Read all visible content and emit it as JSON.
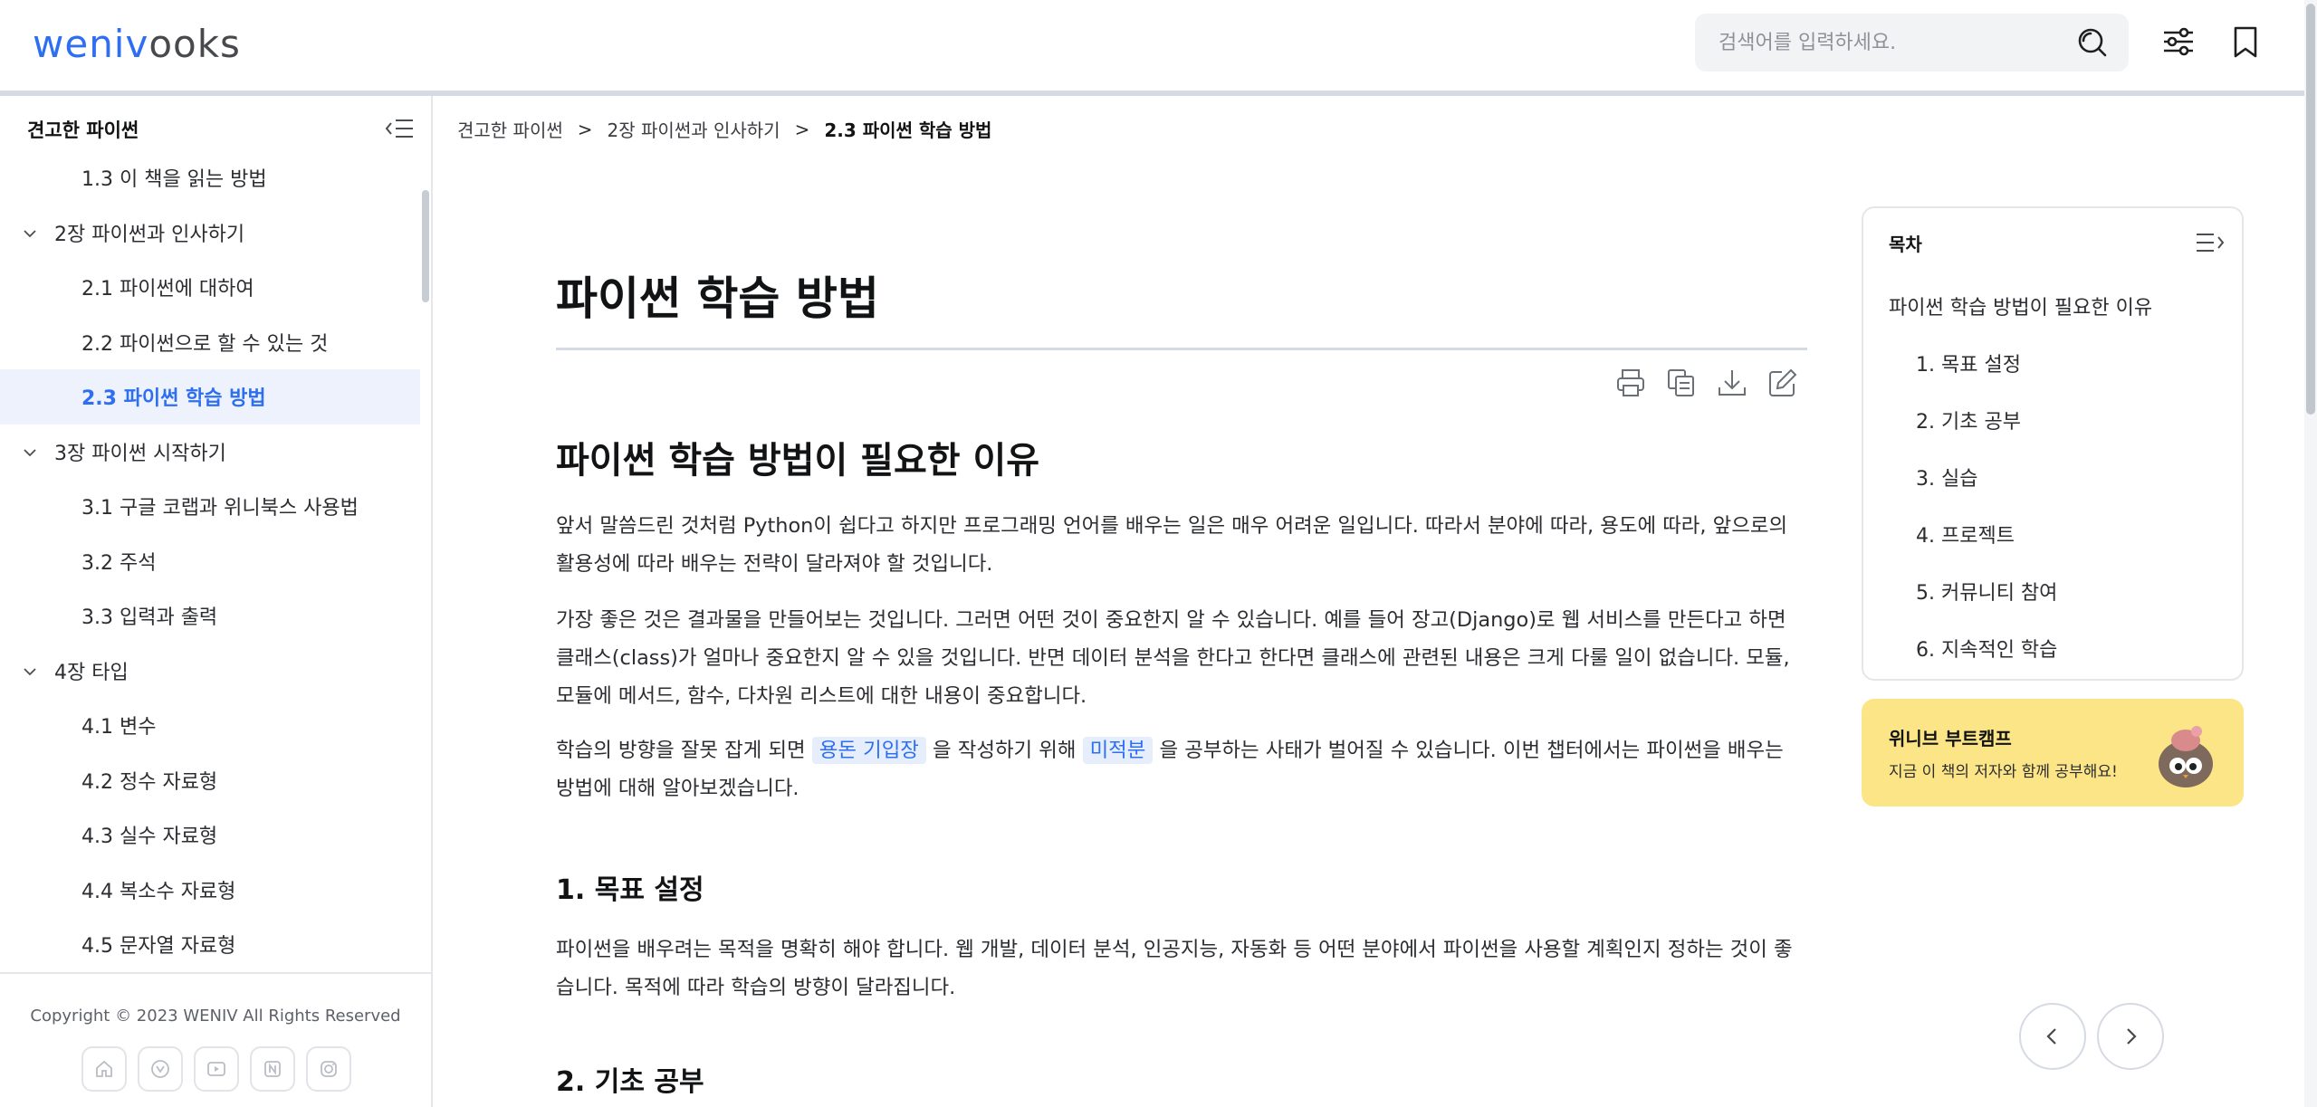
{
  "header": {
    "logo_primary": "weniv",
    "logo_secondary": "ooks",
    "search_placeholder": "검색어를 입력하세요."
  },
  "sidebar": {
    "title": "견고한 파이썬",
    "items": [
      {
        "label": "1.3 이 책을 읽는 방법",
        "level": "sub"
      },
      {
        "label": "2장 파이썬과 인사하기",
        "level": "chap"
      },
      {
        "label": "2.1 파이썬에 대하여",
        "level": "sub"
      },
      {
        "label": "2.2 파이썬으로 할 수 있는 것",
        "level": "sub"
      },
      {
        "label": "2.3 파이썬 학습 방법",
        "level": "sub",
        "active": true
      },
      {
        "label": "3장 파이썬 시작하기",
        "level": "chap"
      },
      {
        "label": "3.1 구글 코랩과 위니북스 사용법",
        "level": "sub"
      },
      {
        "label": "3.2 주석",
        "level": "sub"
      },
      {
        "label": "3.3 입력과 출력",
        "level": "sub"
      },
      {
        "label": "4장 타입",
        "level": "chap"
      },
      {
        "label": "4.1 변수",
        "level": "sub"
      },
      {
        "label": "4.2 정수 자료형",
        "level": "sub"
      },
      {
        "label": "4.3 실수 자료형",
        "level": "sub"
      },
      {
        "label": "4.4 복소수 자료형",
        "level": "sub"
      },
      {
        "label": "4.5 문자열 자료형",
        "level": "sub"
      }
    ],
    "copyright": "Copyright © 2023 WENIV All Rights Reserved"
  },
  "breadcrumb": {
    "items": [
      "견고한 파이썬",
      "2장 파이썬과 인사하기",
      "2.3 파이썬 학습 방법"
    ],
    "separator": ">"
  },
  "main": {
    "title": "파이썬 학습 방법",
    "section_title": "파이썬 학습 방법이 필요한 이유",
    "p1": "앞서 말씀드린 것처럼 Python이 쉽다고 하지만 프로그래밍 언어를 배우는 일은 매우 어려운 일입니다. 따라서 분야에 따라, 용도에 따라, 앞으로의 활용성에 따라 배우는 전략이 달라져야 할 것입니다.",
    "p2": "가장 좋은 것은 결과물을 만들어보는 것입니다. 그러면 어떤 것이 중요한지 알 수 있습니다. 예를 들어 장고(Django)로 웹 서비스를 만든다고 하면 클래스(class)가 얼마나 중요한지 알 수 있을 것입니다. 반면 데이터 분석을 한다고 한다면 클래스에 관련된 내용은 크게 다룰 일이 없습니다. 모듈, 모듈에 메서드, 함수, 다차원 리스트에 대한 내용이 중요합니다.",
    "p3_a": "학습의 방향을 잘못 잡게 되면 ",
    "p3_hl1": "용돈 기입장",
    "p3_b": " 을 작성하기 위해 ",
    "p3_hl2": "미적분",
    "p3_c": " 을 공부하는 사태가 벌어질 수 있습니다. 이번 챕터에서는 파이썬을 배우는 방법에 대해 알아보겠습니다.",
    "h_goal": "1. 목표 설정",
    "p_goal": "파이썬을 배우려는 목적을 명확히 해야 합니다. 웹 개발, 데이터 분석, 인공지능, 자동화 등 어떤 분야에서 파이썬을 사용할 계획인지 정하는 것이 좋습니다. 목적에 따라 학습의 방향이 달라집니다.",
    "h_basic": "2. 기초 공부"
  },
  "toc": {
    "title": "목차",
    "items": [
      "파이썬 학습 방법이 필요한 이유",
      "1. 목표 설정",
      "2. 기초 공부",
      "3. 실습",
      "4. 프로젝트",
      "5. 커뮤니티 참여",
      "6. 지속적인 학습"
    ]
  },
  "promo": {
    "title": "위니브 부트캠프",
    "subtitle": "지금 이 책의 저자와 함께 공부해요!",
    "color": "#fce587"
  },
  "colors": {
    "accent": "#2e6ff2",
    "highlight_bg": "#e6eefc"
  }
}
